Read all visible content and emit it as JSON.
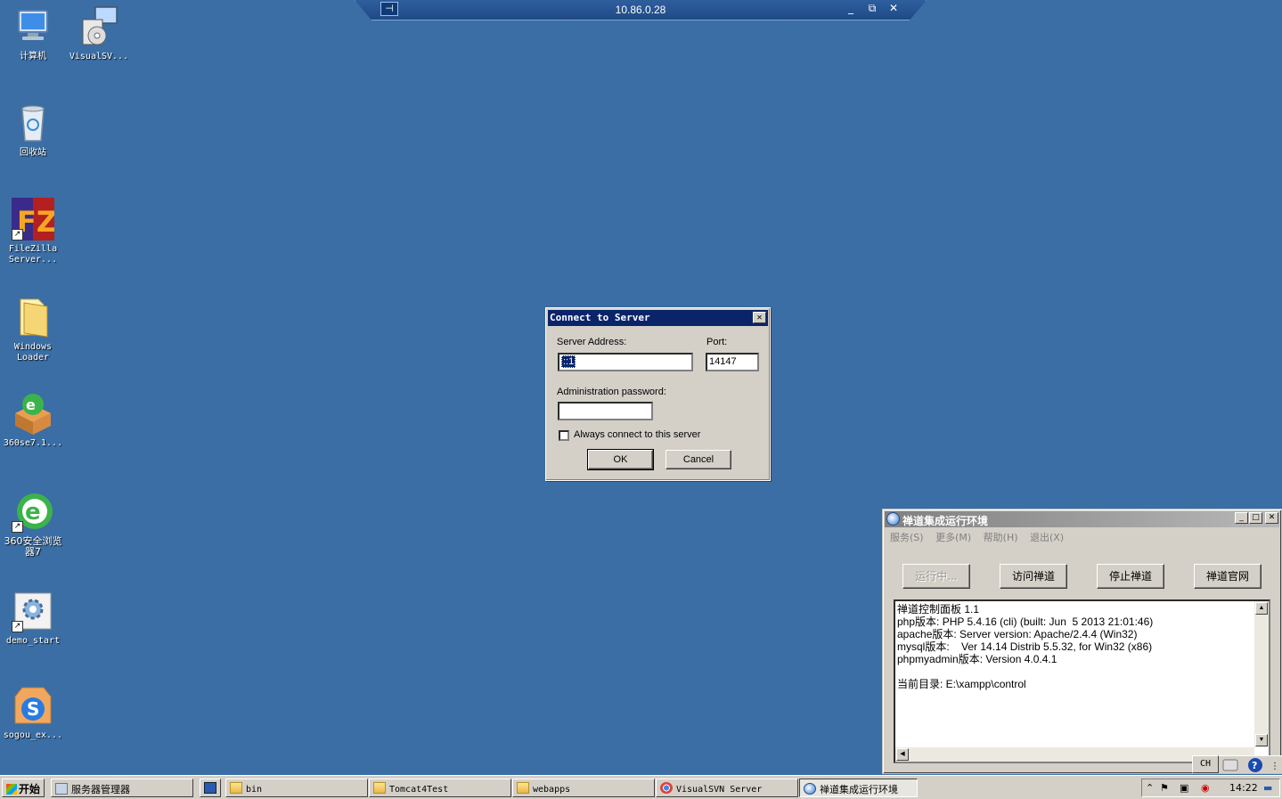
{
  "desktop_icons": [
    {
      "label": "计算机",
      "icon": "computer-icon"
    },
    {
      "label": "VisualSV...",
      "icon": "visualsvn-installer-icon"
    },
    {
      "label": "回收站",
      "icon": "recycle-bin-icon"
    },
    {
      "label": "FileZilla Server...",
      "icon": "filezilla-icon"
    },
    {
      "label": "Windows Loader",
      "icon": "folder-icon"
    },
    {
      "label": "360se7.1...",
      "icon": "360-package-icon"
    },
    {
      "label": "360安全浏览器7",
      "icon": "360-browser-icon"
    },
    {
      "label": "demo_start",
      "icon": "settings-gear-icon"
    },
    {
      "label": "sogou_ex...",
      "icon": "sogou-icon"
    }
  ],
  "rdp_bar": {
    "title": "10.86.0.28",
    "pin": "⊣",
    "minimize": "_",
    "restore": "⧉",
    "close": "✕"
  },
  "connect_dialog": {
    "title": "Connect to Server",
    "close": "✕",
    "server_address_label": "Server Address:",
    "server_address_value": "::1",
    "port_label": "Port:",
    "port_value": "14147",
    "password_label": "Administration password:",
    "password_value": "",
    "always_connect_label": "Always connect to this server",
    "ok_label": "OK",
    "cancel_label": "Cancel"
  },
  "zentao_window": {
    "title": "禅道集成运行环境",
    "menu": [
      "服务(S)",
      "更多(M)",
      "帮助(H)",
      "退出(X)"
    ],
    "buttons": [
      "运行中...",
      "访问禅道",
      "停止禅道",
      "禅道官网"
    ],
    "log_lines": [
      "禅道控制面板 1.1",
      "php版本: PHP 5.4.16 (cli) (built: Jun  5 2013 21:01:46)",
      "apache版本: Server version: Apache/2.4.4 (Win32)",
      "mysql版本:    Ver 14.14 Distrib 5.5.32, for Win32 (x86)",
      "phpmyadmin版本: Version 4.0.4.1",
      "",
      "当前目录: E:\\xampp\\control"
    ]
  },
  "language_bar": {
    "lang": "CH"
  },
  "taskbar": {
    "start_label": "开始",
    "tasks": [
      {
        "label": "服务器管理器"
      },
      {
        "label": "bin"
      },
      {
        "label": "Tomcat4Test"
      },
      {
        "label": "webapps"
      },
      {
        "label": "VisualSVN Server"
      },
      {
        "label": "禅道集成运行环境"
      }
    ],
    "clock": "14:22"
  }
}
